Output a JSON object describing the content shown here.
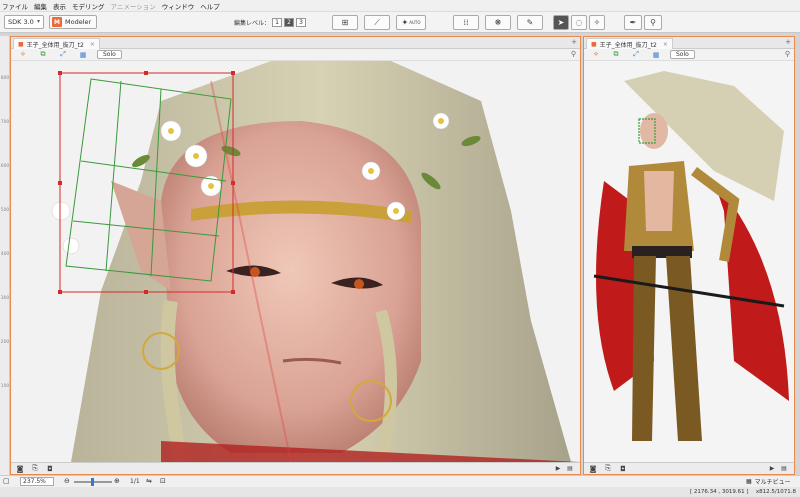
{
  "menu": [
    "ファイル",
    "編集",
    "表示",
    "モデリング",
    "アニメーション",
    "ウィンドウ",
    "ヘルプ"
  ],
  "toolbar": {
    "sdk_label": "SDK 3.0",
    "modeler_label": "Modeler",
    "edit_level_label": "編集レベル：",
    "edit_levels": [
      "1",
      "2",
      "3"
    ],
    "active_level": "2",
    "auto_label": "AUTO"
  },
  "left_view": {
    "tab_title": "王子_全体用_抜刀_t2",
    "solo_label": "Solo",
    "ruler_ticks": [
      "800",
      "700",
      "600",
      "500",
      "400",
      "300",
      "200",
      "100"
    ]
  },
  "right_view": {
    "tab_title": "王子_全体用_抜刀_t2",
    "solo_label": "Solo"
  },
  "status": {
    "zoom": "237.5%",
    "page": "1/1",
    "multiview_label": "マルチビュー",
    "cursor_coords": "[ 2176.34 , 3019.61 ]",
    "viewport_info": "x812.5/1071.8"
  },
  "colors": {
    "accent": "#e96a3b",
    "panel_border": "#e98a4a",
    "selection_red": "#d42a2a",
    "deformer_green": "#3a9a3a"
  }
}
